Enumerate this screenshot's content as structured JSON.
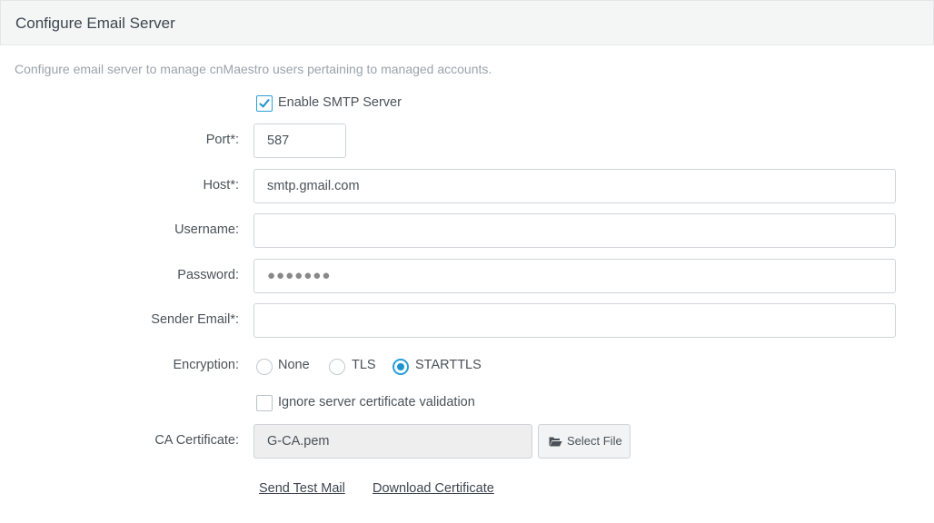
{
  "panel": {
    "title": "Configure Email Server"
  },
  "description": "Configure email server to manage cnMaestro users pertaining to managed accounts.",
  "smtp": {
    "enable_label": "Enable SMTP Server",
    "enabled": true
  },
  "form": {
    "port": {
      "label": "Port*:",
      "value": "587"
    },
    "host": {
      "label": "Host*:",
      "value": "smtp.gmail.com"
    },
    "username": {
      "label": "Username:",
      "value": ""
    },
    "password": {
      "label": "Password:",
      "masked_value": "●●●●●●●"
    },
    "sender_email": {
      "label": "Sender Email*:",
      "value": ""
    },
    "encryption": {
      "label": "Encryption:",
      "options": [
        "None",
        "TLS",
        "STARTTLS"
      ],
      "selected": "STARTTLS"
    },
    "ignore_cert": {
      "label": "Ignore server certificate validation",
      "checked": false
    },
    "ca_certificate": {
      "label": "CA Certificate:",
      "value": "G-CA.pem",
      "button_label": "Select File"
    }
  },
  "links": {
    "send_test_mail": "Send Test Mail",
    "download_certificate": "Download Certificate"
  },
  "colors": {
    "accent": "#1f93cf",
    "header_bg": "#f4f5f5",
    "muted_text": "#9aa3ab"
  },
  "icons": {
    "checkbox_tick": "check-icon",
    "select_file": "folder-open-icon"
  }
}
